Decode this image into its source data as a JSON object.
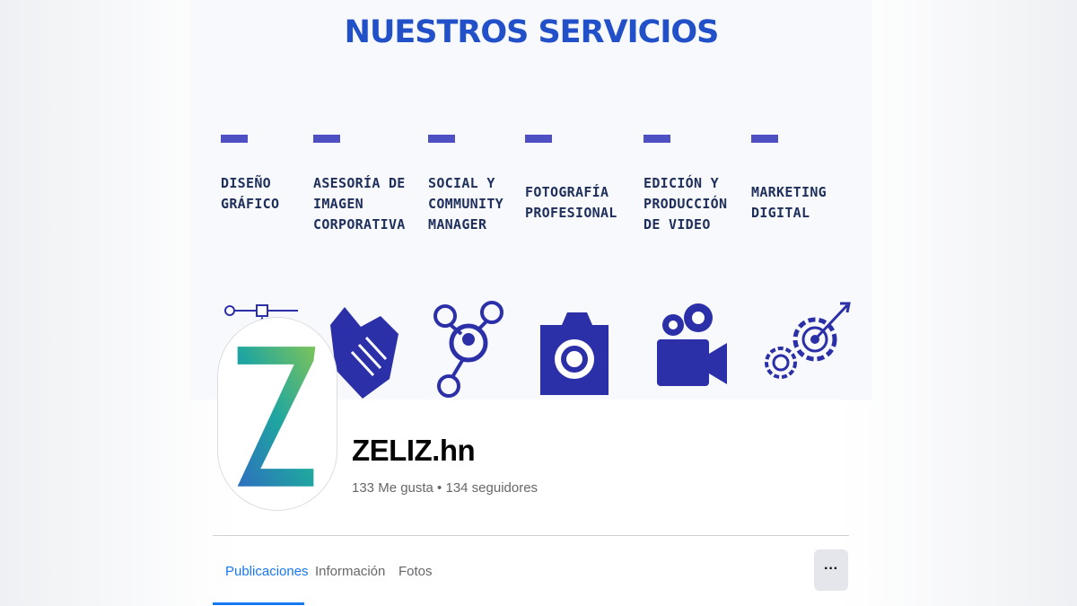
{
  "cover": {
    "title": "NUESTROS SERVICIOS",
    "services": [
      {
        "label": "DISEÑO\nGRÁFICO",
        "icon": "vector-pen-icon"
      },
      {
        "label": "ASESORÍA DE\nIMAGEN\nCORPORATIVA",
        "icon": "handshake-icon"
      },
      {
        "label": "SOCIAL Y\nCOMMUNITY\nMANAGER",
        "icon": "social-network-icon"
      },
      {
        "label": "FOTOGRAFÍA\nPROFESIONAL",
        "icon": "camera-icon"
      },
      {
        "label": "EDICIÓN Y\nPRODUCCIÓN\nDE VIDEO",
        "icon": "video-camera-icon"
      },
      {
        "label": "MARKETING\nDIGITAL",
        "icon": "gears-target-icon"
      }
    ],
    "accent_color": "#2150c8",
    "bar_color": "#4e4fc3",
    "icon_color": "#2b2fa8"
  },
  "profile": {
    "name": "ZELIZ.hn",
    "stats": "133 Me gusta • 134 seguidores",
    "logo_icon": "zeliz-z-logo-icon"
  },
  "tabs": [
    {
      "label": "Publicaciones",
      "active": true
    },
    {
      "label": "Información",
      "active": false
    },
    {
      "label": "Fotos",
      "active": false
    }
  ],
  "more_button": "···",
  "colors": {
    "tab_active": "#1877f2",
    "tab_inactive": "#65676b"
  }
}
